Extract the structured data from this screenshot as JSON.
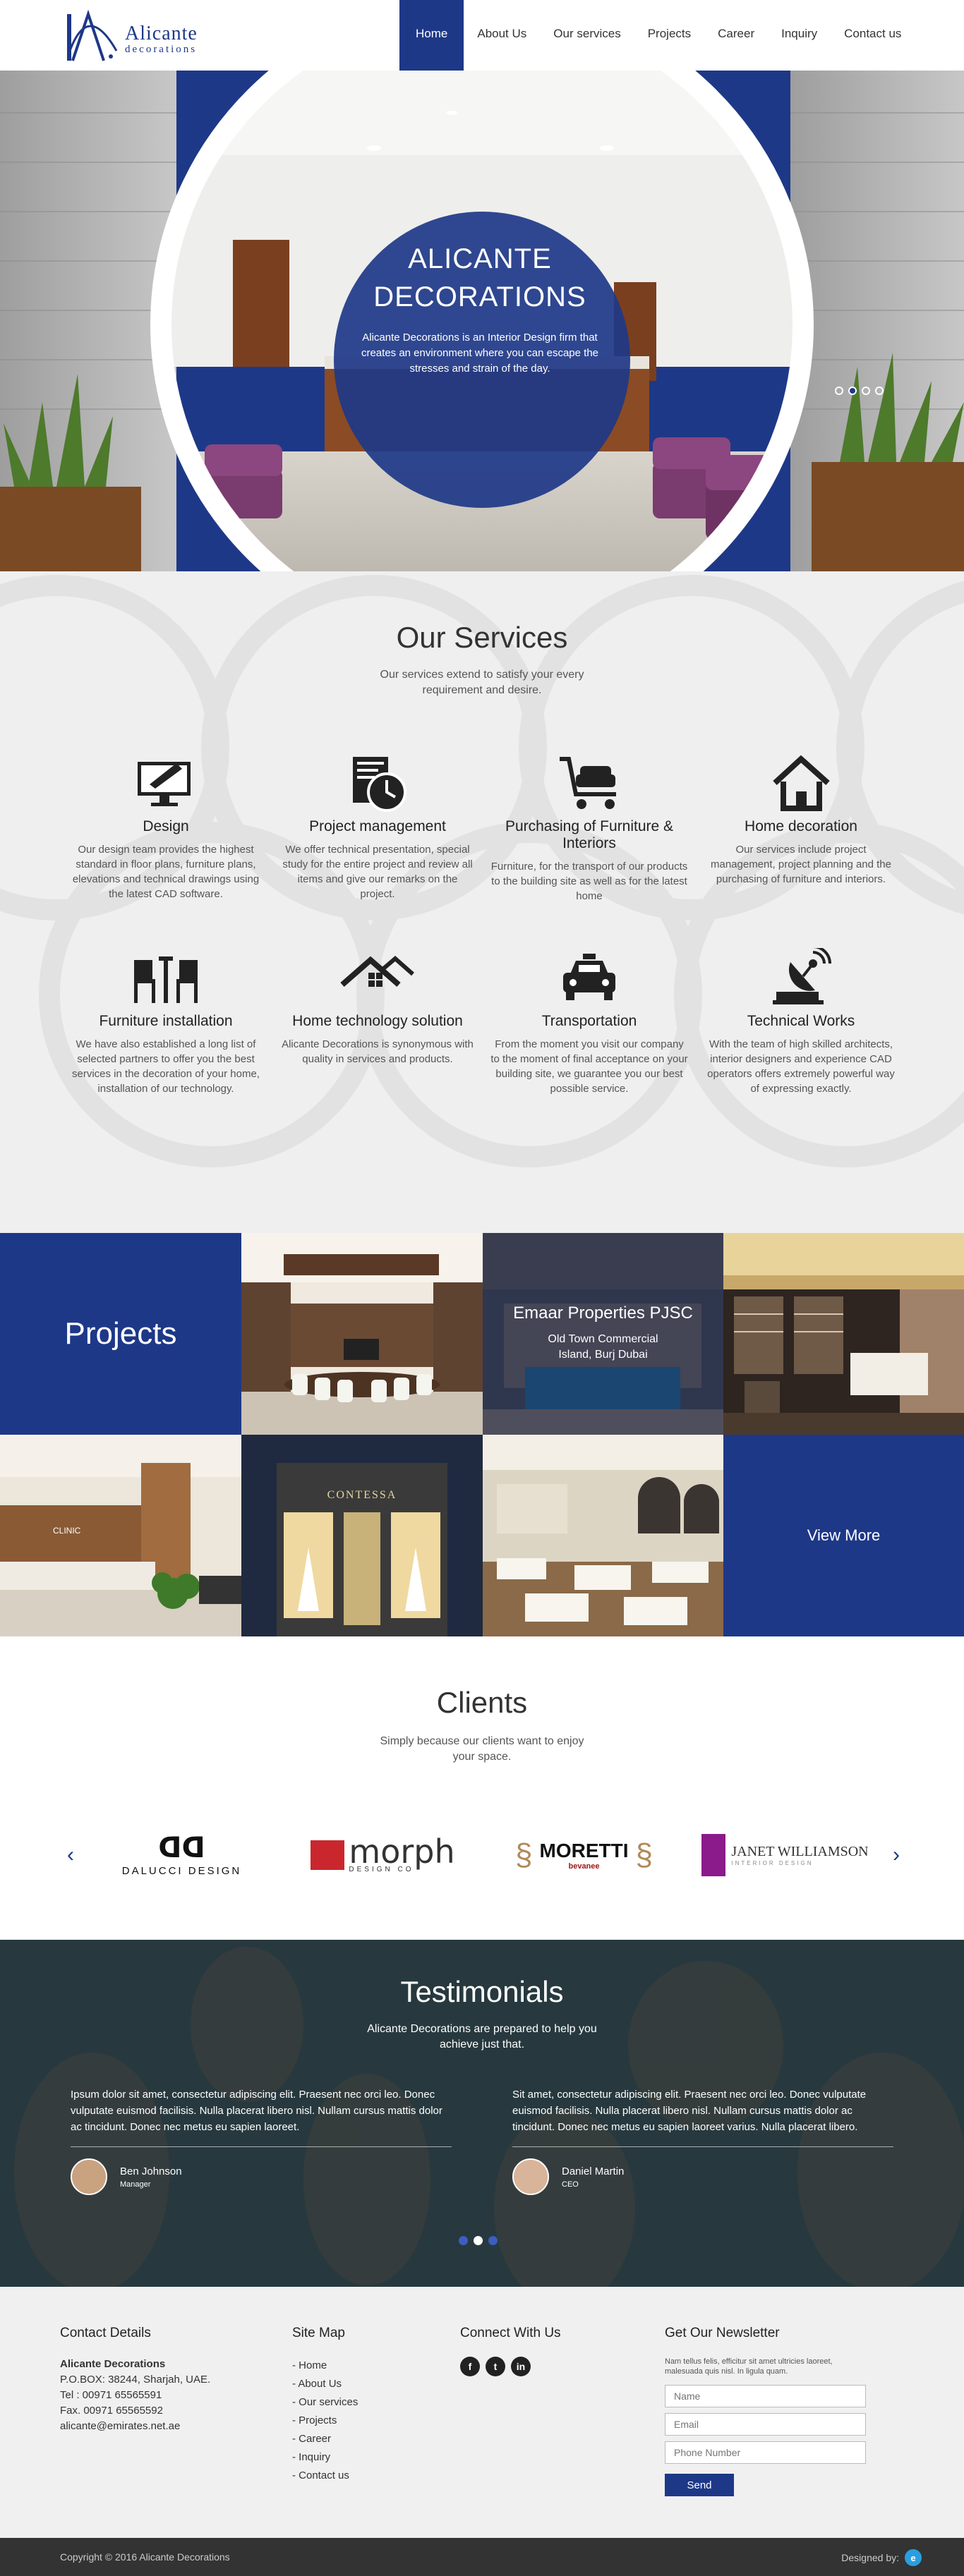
{
  "header": {
    "logo_name": "Alicante",
    "logo_sub": "decorations",
    "nav": [
      "Home",
      "About Us",
      "Our services",
      "Projects",
      "Career",
      "Inquiry",
      "Contact us"
    ]
  },
  "hero": {
    "title_line1": "ALICANTE",
    "title_line2": "DECORATIONS",
    "description": "Alicante Decorations is an Interior Design firm that creates an environment where you can escape the stresses and strain of the day."
  },
  "services": {
    "title": "Our Services",
    "subtitle": "Our services extend to satisfy your every requirement and desire.",
    "items": [
      {
        "title": "Design",
        "text": "Our design team provides the highest standard in floor plans, furniture plans, elevations and technical drawings using the latest CAD software.",
        "icon": "drawing-monitor-icon"
      },
      {
        "title": "Project management",
        "text": "We offer technical presentation, special study for the entire project and review all items and give our remarks on the project.",
        "icon": "clock-document-icon"
      },
      {
        "title": "Purchasing of Furniture & Interiors",
        "text": "Furniture, for the transport of our products to the building site as well as for the latest home",
        "icon": "sofa-cart-icon"
      },
      {
        "title": "Home decoration",
        "text": "Our services include project management, project planning and the purchasing of furniture and interiors.",
        "icon": "home-icon"
      },
      {
        "title": "Furniture installation",
        "text": "We have also established a long list of selected partners to offer you the best services in the decoration of your home, installation of our technology.",
        "icon": "chairs-icon"
      },
      {
        "title": "Home technology solution",
        "text": "Alicante Decorations is synonymous with quality in services and products.",
        "icon": "house-tech-icon"
      },
      {
        "title": "Transportation",
        "text": "From the moment you visit our company to the moment of final acceptance on your building site, we guarantee you our best possible service.",
        "icon": "taxi-icon"
      },
      {
        "title": "Technical Works",
        "text": "With the team of high skilled architects, interior designers and experience CAD operators offers extremely powerful way of expressing exactly.",
        "icon": "satellite-dish-icon"
      }
    ]
  },
  "projects": {
    "title": "Projects",
    "featured_title": "Emaar Properties PJSC",
    "featured_location": "Old Town Commercial Island, Burj Dubai",
    "clinic_sign": "CLINIC",
    "store_sign": "CONTESSA",
    "view_more": "View More"
  },
  "clients": {
    "title": "Clients",
    "subtitle": "Simply because our clients want to enjoy your space.",
    "logos": [
      {
        "name": "DALUCCI DESIGN"
      },
      {
        "name": "morph",
        "sub": "DESIGN CO"
      },
      {
        "name": "MORETTI",
        "sub": "bevanee"
      },
      {
        "name": "JANET WILLIAMSON",
        "sub": "INTERIOR DESIGN"
      }
    ]
  },
  "testimonials": {
    "title": "Testimonials",
    "subtitle": "Alicante Decorations are prepared to help you achieve just that.",
    "items": [
      {
        "text": "Ipsum dolor sit amet, consectetur adipiscing elit. Praesent nec orci leo. Donec vulputate euismod facilisis. Nulla placerat libero nisl. Nullam cursus mattis dolor ac tincidunt. Donec nec metus eu sapien laoreet.",
        "name": "Ben Johnson",
        "role": "Manager"
      },
      {
        "text": "Sit amet, consectetur adipiscing elit. Praesent nec orci leo. Donec vulputate euismod facilisis. Nulla placerat libero nisl. Nullam cursus mattis dolor ac tincidunt. Donec nec metus eu sapien laoreet varius. Nulla placerat libero.",
        "name": "Daniel Martin",
        "role": "CEO"
      }
    ]
  },
  "footer": {
    "contact_title": "Contact Details",
    "company": "Alicante Decorations",
    "address": "P.O.BOX: 38244, Sharjah, UAE.",
    "tel": "Tel : 00971 65565591",
    "fax": "Fax. 00971 65565592",
    "email": "alicante@emirates.net.ae",
    "sitemap_title": "Site Map",
    "sitemap": [
      "- Home",
      "- About Us",
      "- Our services",
      "- Projects",
      "- Career",
      "- Inquiry",
      "- Contact us"
    ],
    "connect_title": "Connect With Us",
    "newsletter_title": "Get Our Newsletter",
    "newsletter_desc": "Nam tellus felis, efficitur sit amet ultricies laoreet, malesuada quis nisl. In ligula quam.",
    "placeholder_name": "Name",
    "placeholder_email": "Email",
    "placeholder_phone": "Phone Number",
    "send_label": "Send",
    "copyright": "Copyright © 2016 Alicante Decorations",
    "designed_by": "Designed by:",
    "designer_mark": "e"
  },
  "colors": {
    "brand": "#1e3888",
    "dark": "#333333"
  }
}
